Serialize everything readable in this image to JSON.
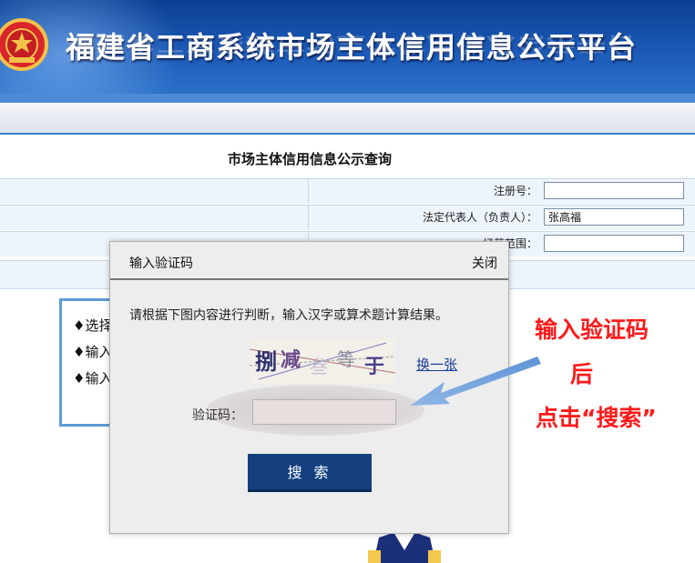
{
  "banner": {
    "title": "福建省工商系统市场主体信用信息公示平台"
  },
  "page": {
    "title": "市场主体信用信息公示查询"
  },
  "form": {
    "fields": [
      {
        "label": "注册号：",
        "value": ""
      },
      {
        "label": "法定代表人（负责人）：",
        "value": "张高福"
      },
      {
        "label": "经营范围：",
        "value": ""
      }
    ]
  },
  "tips": [
    "♦选择",
    "♦输入",
    "♦输入"
  ],
  "modal": {
    "title": "输入验证码",
    "close": "关闭",
    "instruction": "请根据下图内容进行判断，输入汉字或算术题计算结果。",
    "captcha_text": "捌减叁等于",
    "refresh": "换一张",
    "code_label": "验证码：",
    "code_value": "",
    "search_button": "搜 索"
  },
  "annotation": {
    "line1": "输入验证码",
    "line2": "后",
    "line3": "点击“搜索”"
  },
  "colors": {
    "banner": "#1d5cb9",
    "button": "#14407f",
    "annotation": "#ff1a1a",
    "link": "#1a3d9c"
  }
}
